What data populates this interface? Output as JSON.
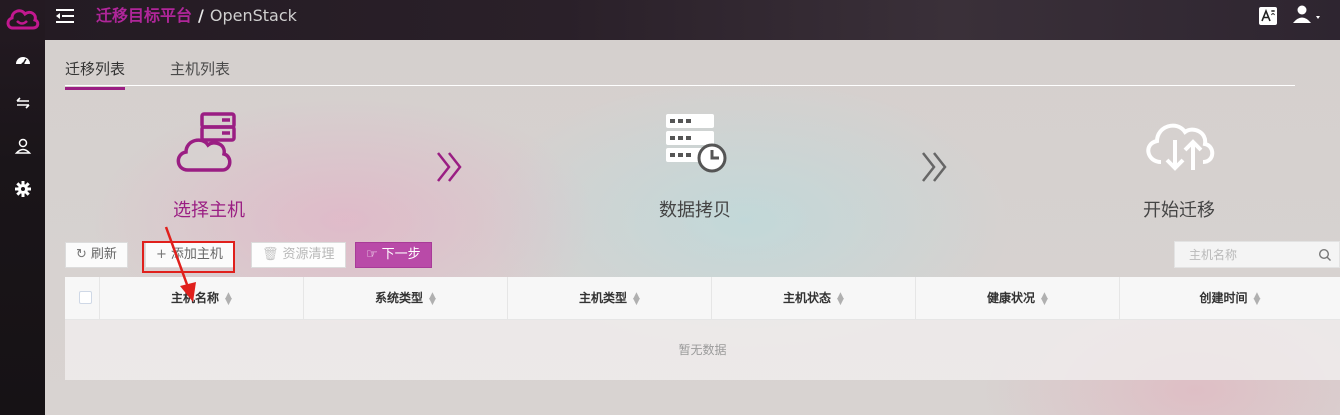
{
  "header": {
    "breadcrumb_root": "迁移目标平台",
    "separator": "/",
    "breadcrumb_current": "OpenStack"
  },
  "tabs": [
    {
      "label": "迁移列表",
      "active": true
    },
    {
      "label": "主机列表",
      "active": false
    }
  ],
  "steps": [
    {
      "label": "选择主机",
      "icon": "cloud-server-icon",
      "color": "#9a1e83"
    },
    {
      "label": "数据拷贝",
      "icon": "server-clock-icon",
      "color": "#444444"
    },
    {
      "label": "开始迁移",
      "icon": "cloud-transfer-icon",
      "color": "#444444"
    }
  ],
  "toolbar": {
    "refresh": "刷新",
    "add_host": "添加主机",
    "cleanup": "资源清理",
    "next": "下一步"
  },
  "search": {
    "placeholder": "主机名称"
  },
  "table": {
    "columns": [
      "主机名称",
      "系统类型",
      "主机类型",
      "主机状态",
      "健康状况",
      "创建时间"
    ],
    "empty_text": "暂无数据"
  },
  "colors": {
    "accent": "#9a1e83",
    "primary_button": "#b94aa8",
    "highlight": "#e0201c"
  }
}
